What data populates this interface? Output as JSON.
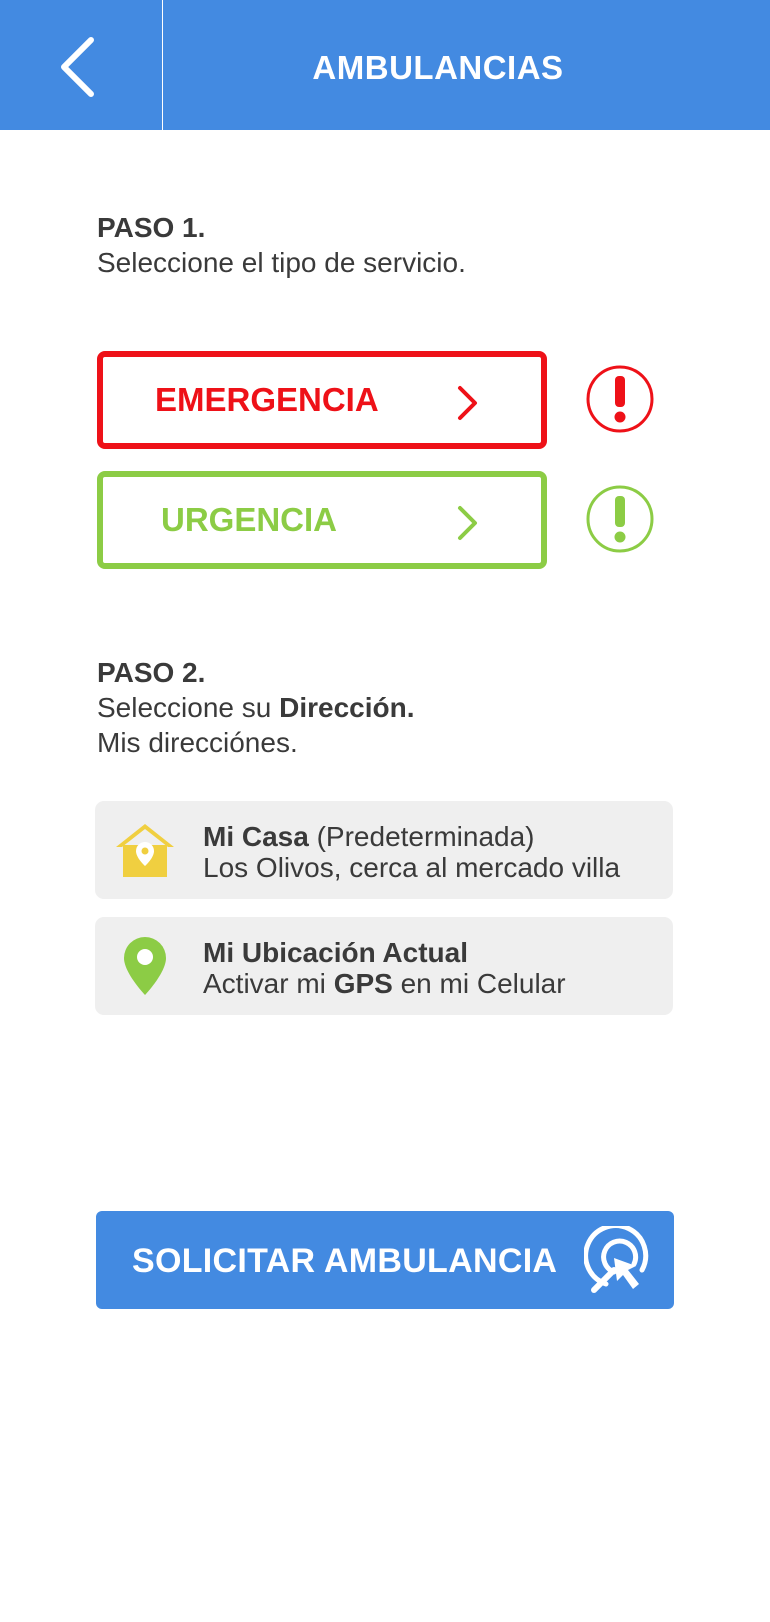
{
  "header": {
    "title": "AMBULANCIAS",
    "back_icon": "chevron-left-icon"
  },
  "step1": {
    "heading": "PASO 1.",
    "text": "Seleccione el tipo de servicio."
  },
  "services": [
    {
      "label": "EMERGENCIA",
      "color": "#ee1118",
      "icon": "exclamation-circle-icon"
    },
    {
      "label": "URGENCIA",
      "color": "#8ccc45",
      "icon": "exclamation-circle-icon"
    }
  ],
  "step2": {
    "heading": "PASO 2.",
    "text_prefix": "Seleccione su ",
    "text_bold": "Dirección.",
    "subtitle": "Mis direcciónes."
  },
  "addresses": [
    {
      "name": "Mi Casa",
      "tag": " (Predeterminada)",
      "detail": "Los Olivos, cerca al mercado villa",
      "icon": "home-location-icon",
      "icon_color": "#f0cf40"
    },
    {
      "name": "Mi Ubicación Actual",
      "detail_prefix": "Activar mi ",
      "detail_bold": "GPS",
      "detail_suffix": " en mi Celular",
      "icon": "map-pin-icon",
      "icon_color": "#8ccc45"
    }
  ],
  "cta": {
    "label": "SOLICITAR AMBULANCIA",
    "icon": "tap-target-icon"
  },
  "colors": {
    "primary": "#438ae1",
    "emergency": "#ee1118",
    "urgency": "#8ccc45",
    "card_bg": "#efefef",
    "text": "#3a3a3a"
  }
}
